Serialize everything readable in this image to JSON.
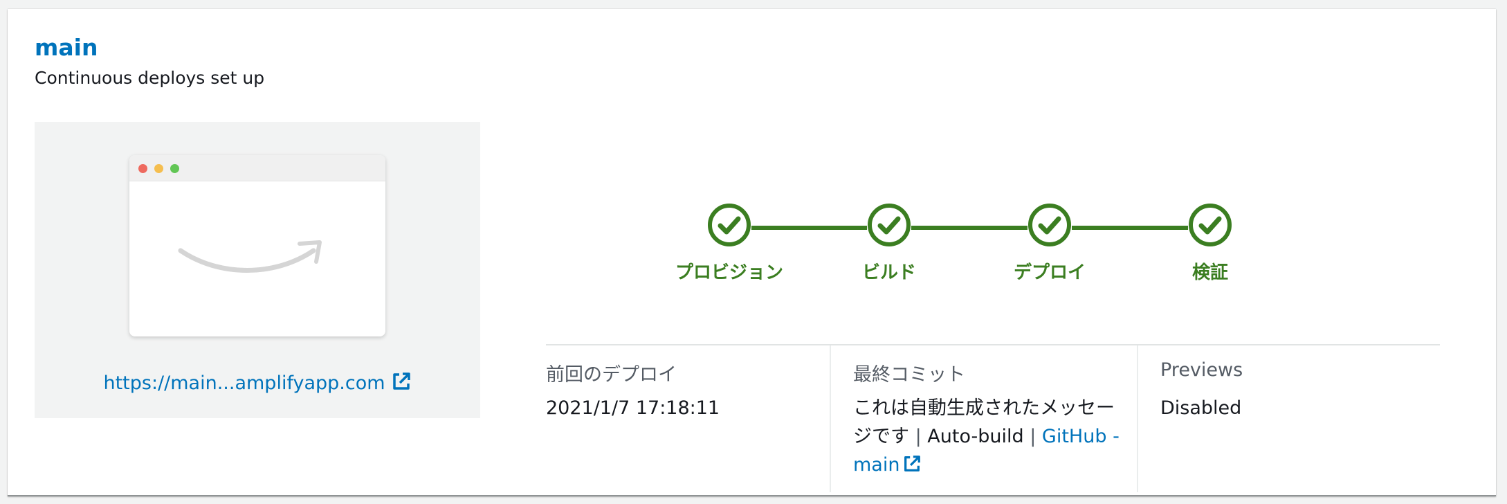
{
  "branch": {
    "name": "main",
    "subtitle": "Continuous deploys set up"
  },
  "preview": {
    "url_label": "https://main...amplifyapp.com",
    "window_dots": [
      "#ee6a5f",
      "#f5be4f",
      "#62c655"
    ],
    "logo": "amazon-smile-logo"
  },
  "steps": [
    {
      "label": "プロビジョン",
      "status": "complete"
    },
    {
      "label": "ビルド",
      "status": "complete"
    },
    {
      "label": "デプロイ",
      "status": "complete"
    },
    {
      "label": "検証",
      "status": "complete"
    }
  ],
  "details": {
    "last_deploy": {
      "title": "前回のデプロイ",
      "value": "2021/1/7 17:18:11"
    },
    "last_commit": {
      "title": "最終コミット",
      "message": "これは自動生成されたメッセージです",
      "separator": "|",
      "source": "Auto-build",
      "link_label": "GitHub - main"
    },
    "previews": {
      "title": "Previews",
      "value": "Disabled"
    }
  },
  "colors": {
    "link": "#0073bb",
    "success": "#3b7e21",
    "text": "#16191f",
    "muted": "#545b64"
  }
}
